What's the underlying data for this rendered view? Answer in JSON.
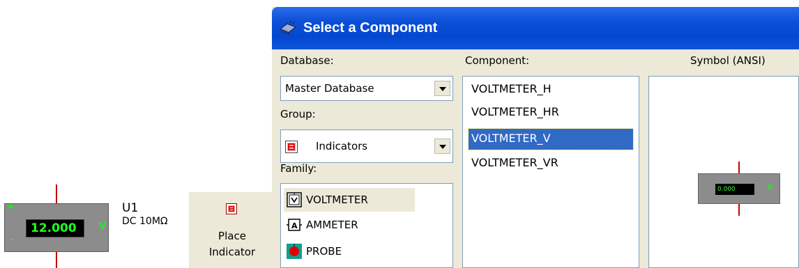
{
  "schematic": {
    "reading": "12.000",
    "unit": "V",
    "plus": "+",
    "minus": "-",
    "refdes": "U1",
    "params": "DC  10MΩ"
  },
  "toolbar": {
    "place_button_line1": "Place",
    "place_button_line2": "Indicator"
  },
  "dialog": {
    "title": "Select a Component",
    "database_label": "Database:",
    "database_value": "Master Database",
    "group_label": "Group:",
    "group_value": "Indicators",
    "family_label": "Family:",
    "families": [
      {
        "label": "VOLTMETER",
        "icon": "voltmeter-icon",
        "selected": true
      },
      {
        "label": "AMMETER",
        "icon": "ammeter-icon",
        "selected": false
      },
      {
        "label": "PROBE",
        "icon": "probe-icon",
        "selected": false
      }
    ],
    "component_label": "Component:",
    "components": [
      {
        "label": "VOLTMETER_H",
        "selected": false
      },
      {
        "label": "VOLTMETER_HR",
        "selected": false
      },
      {
        "label": "VOLTMETER_V",
        "selected": true
      },
      {
        "label": "VOLTMETER_VR",
        "selected": false
      }
    ],
    "symbol_label": "Symbol (ANSI)",
    "symbol_reading": "0.000",
    "symbol_unit": "V"
  },
  "colors": {
    "titlebar": "#0548d0",
    "selection": "#316ac5",
    "meter_text": "#22ff22",
    "dialog_bg": "#ece9d8"
  }
}
